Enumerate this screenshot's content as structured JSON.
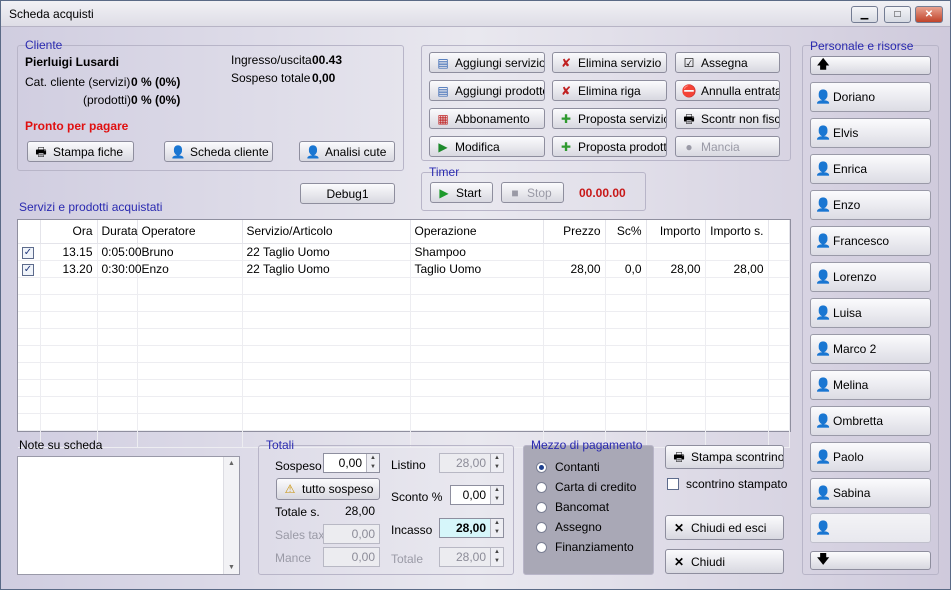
{
  "window": {
    "title": "Scheda acquisti",
    "min": "▁",
    "max": "□",
    "close": "✕"
  },
  "cliente": {
    "legend": "Cliente",
    "name": "Pierluigi Lusardi",
    "cat_label": "Cat. cliente (servizi)",
    "cat_value": "0 % (0%)",
    "prod_label": "(prodotti)",
    "prod_value": "0 % (0%)",
    "ingresso_label": "Ingresso/uscita",
    "ingresso_value": "00.43",
    "sospeso_label": "Sospeso totale",
    "sospeso_value": "0,00",
    "status": "Pronto per pagare",
    "btn_stampa": "Stampa fiche",
    "btn_scheda": "Scheda cliente",
    "btn_analisi": "Analisi cute"
  },
  "actions": {
    "aggiungi_servizio": "Aggiungi servizio",
    "aggiungi_prodotto": "Aggiungi prodotto",
    "abbonamento": "Abbonamento",
    "modifica": "Modifica",
    "elimina_servizio": "Elimina servizio",
    "elimina_riga": "Elimina riga",
    "proposta_servizio": "Proposta servizio",
    "proposta_prodotto": "Proposta prodotto",
    "assegna": "Assegna",
    "annulla_entrata": "Annulla entrata",
    "scontr_non_fisc": "Scontr non fisc",
    "mancia": "Mancia"
  },
  "debug": "Debug1",
  "timer": {
    "legend": "Timer",
    "start": "Start",
    "stop": "Stop",
    "value": "00.00.00"
  },
  "table": {
    "title": "Servizi e prodotti acquistati",
    "columns": [
      "",
      "Ora",
      "Durata",
      "Operatore",
      "Servizio/Articolo",
      "Operazione",
      "Prezzo",
      "Sc%",
      "Importo",
      "Importo s."
    ],
    "rows": [
      {
        "checked": "✓",
        "ora": "13.15",
        "durata": "0:05:00",
        "operatore": "Bruno",
        "servizio": "22 Taglio Uomo",
        "operazione": "Shampoo",
        "prezzo": "",
        "sc": "",
        "importo": "",
        "importo_s": ""
      },
      {
        "checked": "✓",
        "ora": "13.20",
        "durata": "0:30:00",
        "operatore": "Enzo",
        "servizio": "22 Taglio Uomo",
        "operazione": "Taglio Uomo",
        "prezzo": "28,00",
        "sc": "0,0",
        "importo": "28,00",
        "importo_s": "28,00"
      }
    ]
  },
  "note": {
    "label": "Note su scheda"
  },
  "totali": {
    "legend": "Totali",
    "sospeso_label": "Sospeso",
    "sospeso_value": "0,00",
    "tutto_sospeso": "tutto sospeso",
    "totale_s_label": "Totale s.",
    "totale_s_value": "28,00",
    "sales_tax_label": "Sales tax",
    "sales_tax_value": "0,00",
    "mance_label": "Mance",
    "mance_value": "0,00",
    "listino_label": "Listino",
    "listino_value": "28,00",
    "sconto_label": "Sconto %",
    "sconto_value": "0,00",
    "incasso_label": "Incasso",
    "incasso_value": "28,00",
    "totale_label": "Totale",
    "totale_value": "28,00"
  },
  "pagamento": {
    "legend": "Mezzo di pagamento",
    "options": [
      "Contanti",
      "Carta di credito",
      "Bancomat",
      "Assegno",
      "Finanziamento"
    ],
    "selected": "Contanti"
  },
  "right_actions": {
    "stampa_scontrino": "Stampa scontrino",
    "scontrino_stampato": "scontrino stampato",
    "chiudi_esci": "Chiudi ed esci",
    "chiudi": "Chiudi"
  },
  "personale": {
    "legend": "Personale e risorse",
    "up": "🡅",
    "down": "🡇",
    "items": [
      "Doriano",
      "Elvis",
      "Enrica",
      "Enzo",
      "Francesco",
      "Lorenzo",
      "Luisa",
      "Marco 2",
      "Melina",
      "Ombretta",
      "Paolo",
      "Sabina"
    ]
  },
  "colors": {
    "accent": "#2a2ab0",
    "status_red": "#e01010",
    "timer_red": "#c81818",
    "incasso_bg": "#d6f6fa"
  }
}
